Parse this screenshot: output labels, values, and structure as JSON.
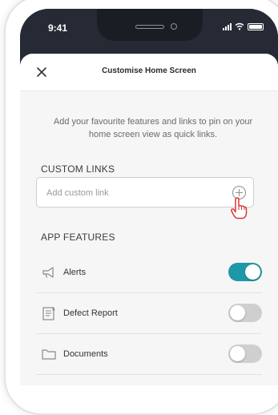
{
  "status_bar": {
    "time": "9:41"
  },
  "header": {
    "title": "Customise Home Screen"
  },
  "description": "Add your favourite features and links to pin on your home screen view as quick links.",
  "custom_links": {
    "section_label": "CUSTOM LINKS",
    "placeholder": "Add custom link"
  },
  "app_features": {
    "section_label": "APP FEATURES",
    "items": [
      {
        "label": "Alerts",
        "icon": "megaphone-icon",
        "enabled": true
      },
      {
        "label": "Defect Report",
        "icon": "report-icon",
        "enabled": false
      },
      {
        "label": "Documents",
        "icon": "folder-icon",
        "enabled": false
      }
    ]
  },
  "colors": {
    "toggle_on": "#1e97a8",
    "toggle_off": "#cfcfcf",
    "status_bar": "#252a34"
  }
}
